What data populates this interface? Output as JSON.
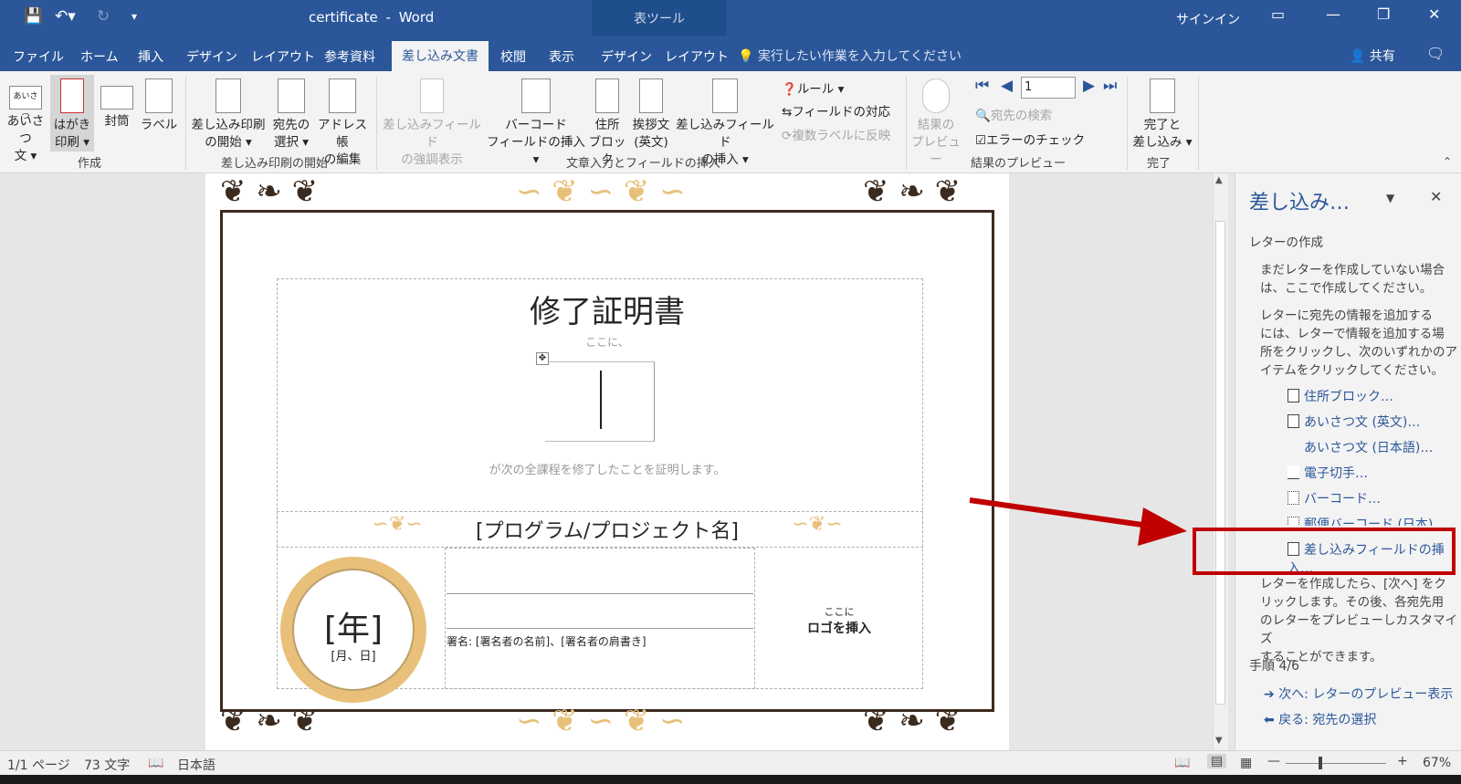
{
  "titlebar": {
    "doc_name": "certificate",
    "sep": "-",
    "app": "Word",
    "context_tab": "表ツール",
    "signin": "サインイン"
  },
  "tabs": [
    "ファイル",
    "ホーム",
    "挿入",
    "デザイン",
    "レイアウト",
    "参考資料",
    "差し込み文書",
    "校閲",
    "表示",
    "デザイン",
    "レイアウト"
  ],
  "tellme": "実行したい作業を入力してください",
  "share": "共有",
  "ribbon": {
    "create": {
      "aisatsu_1": "あいさつ",
      "aisatsu_2": "文 ▾",
      "hagaki_1": "はがき",
      "hagaki_2": "印刷 ▾",
      "futo": "封筒",
      "label": "ラベル",
      "group": "作成",
      "aisatsu_icon_text": "あいさつ"
    },
    "start": {
      "b1_1": "差し込み印刷",
      "b1_2": "の開始 ▾",
      "b2_1": "宛先の",
      "b2_2": "選択 ▾",
      "b3_1": "アドレス帳",
      "b3_2": "の編集",
      "group": "差し込み印刷の開始"
    },
    "write": {
      "b1_1": "差し込みフィールド",
      "b1_2": "の強調表示",
      "b2_1": "バーコード",
      "b2_2": "フィールドの挿入 ▾",
      "b3_1": "住所",
      "b3_2": "ブロック",
      "b4_1": "挨拶文",
      "b4_2": "(英文)",
      "b5_1": "差し込みフィールド",
      "b5_2": "の挿入 ▾",
      "rule": "ルール ▾",
      "match": "フィールドの対応",
      "copy": "複数ラベルに反映",
      "group": "文章入力とフィールドの挿入"
    },
    "preview": {
      "b1_1": "結果の",
      "b1_2": "プレビュー",
      "record": "1",
      "find": "宛先の検索",
      "check": "エラーのチェック",
      "group": "結果のプレビュー"
    },
    "finish": {
      "b1_1": "完了と",
      "b1_2": "差し込み ▾",
      "group": "完了"
    }
  },
  "doc": {
    "title": "修了証明書",
    "small_here": "ここに、",
    "statement": "が次の全課程を修了したことを証明します。",
    "program": "[プログラム/プロジェクト名]",
    "year": "[年]",
    "monthday": "[月、日]",
    "signer": "署名: [署名者の名前]、[署名者の肩書き]",
    "logo_1": "ここに",
    "logo_2": "ロゴを挿入"
  },
  "pane": {
    "title": "差し込み…",
    "heading": "レターの作成",
    "p1": [
      "まだレターを作成していない場合",
      "は、ここで作成してください。"
    ],
    "p2": [
      "レターに宛先の情報を追加する",
      "には、レターで情報を追加する場",
      "所をクリックし、次のいずれかのア",
      "イテムをクリックしてください。"
    ],
    "links": [
      "住所ブロック…",
      "あいさつ文 (英文)…",
      "あいさつ文 (日本語)…",
      "電子切手…",
      "バーコード…",
      "郵便バーコード (日本)…",
      "差し込みフィールドの挿入…"
    ],
    "p3": [
      "レターを作成したら、[次へ] をク",
      "リックします。その後、各宛先用",
      "のレターをプレビューしカスタマイズ",
      "することができます。"
    ],
    "step": "手順 4/6",
    "next": "次へ: レターのプレビュー表示",
    "back": "戻る: 宛先の選択"
  },
  "status": {
    "page": "1/1 ページ",
    "words": "73 文字",
    "lang": "日本語",
    "zoom": "67%"
  },
  "colors": {
    "accent": "#2b579a",
    "highlight": "#c00000",
    "gold": "#e8c07a",
    "ornament": "#3b2a1e"
  }
}
